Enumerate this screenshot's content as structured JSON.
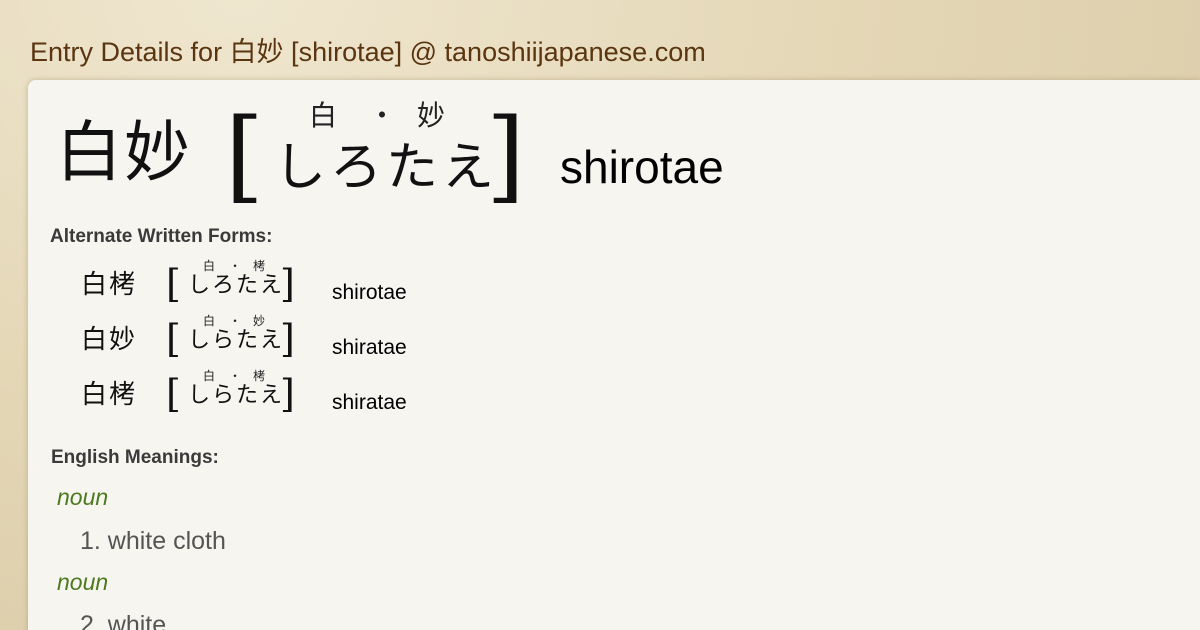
{
  "page_title": "Entry Details for 白妙 [shirotae] @ tanoshiijapanese.com",
  "entry": {
    "kanji": "白妙",
    "furigana": [
      "白",
      "・",
      "妙"
    ],
    "kana": "しろたえ",
    "romaji": "shirotae",
    "open_bracket": "[",
    "close_bracket": "]"
  },
  "alternate_forms": {
    "label": "Alternate Written Forms:",
    "items": [
      {
        "kanji": "白栲",
        "furigana": [
          "白",
          "・",
          "栲"
        ],
        "kana": "しろたえ",
        "romaji": "shirotae"
      },
      {
        "kanji": "白妙",
        "furigana": [
          "白",
          "・",
          "妙"
        ],
        "kana": "しらたえ",
        "romaji": "shiratae"
      },
      {
        "kanji": "白栲",
        "furigana": [
          "白",
          "・",
          "栲"
        ],
        "kana": "しらたえ",
        "romaji": "shiratae"
      }
    ]
  },
  "meanings": {
    "label": "English Meanings:",
    "groups": [
      {
        "pos": "noun",
        "definition": "1. white cloth"
      },
      {
        "pos": "noun",
        "definition": "2. white"
      }
    ]
  }
}
